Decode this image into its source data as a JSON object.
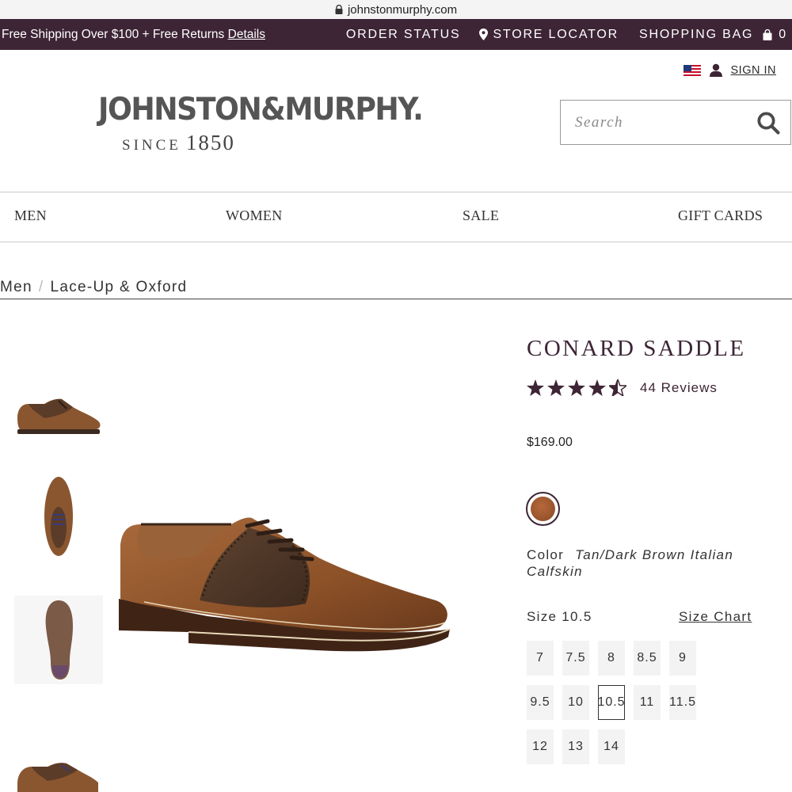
{
  "browser": {
    "url": "johnstonmurphy.com"
  },
  "promo": {
    "message": "Free Shipping Over $100 + Free Returns",
    "details_link": "Details",
    "order_status": "ORDER STATUS",
    "store_locator": "STORE LOCATOR",
    "shopping_bag": "SHOPPING BAG",
    "bag_count": "0"
  },
  "header": {
    "sign_in": "SIGN IN",
    "logo_brand": "JOHNSTON&MURPHY.",
    "logo_since": "SINCE",
    "logo_year": "1850",
    "search_placeholder": "Search"
  },
  "nav": {
    "items": [
      "MEN",
      "WOMEN",
      "SALE",
      "GIFT CARDS"
    ]
  },
  "breadcrumb": {
    "items": [
      "Men",
      "Lace-Up & Oxford"
    ],
    "separator": "/"
  },
  "product": {
    "title": "CONARD SADDLE",
    "rating": 4.5,
    "rating_max": 5,
    "reviews": "44 Reviews",
    "price": "$169.00",
    "color_label": "Color",
    "color_value": "Tan/Dark Brown Italian Calfskin",
    "swatch_color": "#9c5630",
    "size_label": "Size 10.5",
    "size_chart": "Size Chart",
    "sizes": [
      "7",
      "7.5",
      "8",
      "8.5",
      "9",
      "9.5",
      "10",
      "10.5",
      "11",
      "11.5",
      "12",
      "13",
      "14"
    ],
    "selected_size": "10.5"
  },
  "colors": {
    "brand": "#3d2535",
    "accent": "#3d2535",
    "divider": "#c9c9c9",
    "star": "#3d2535"
  }
}
